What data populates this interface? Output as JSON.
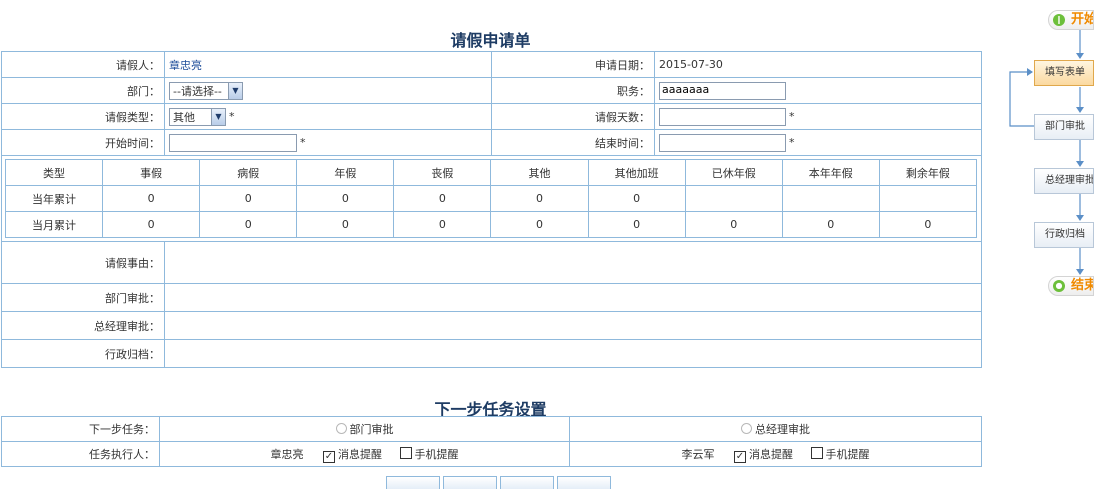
{
  "form": {
    "title": "请假申请单",
    "applicant_label": "请假人：",
    "applicant": "章忠亮",
    "date_label": "申请日期：",
    "date": "2015-07-30",
    "dept_label": "部门：",
    "dept_value": "--请选择--",
    "position_label": "职务：",
    "position_value": "aaaaaaa",
    "leave_type_label": "请假类型：",
    "leave_type_value": "其他",
    "leave_days_label": "请假天数：",
    "leave_days_value": "",
    "start_label": "开始时间：",
    "start_value": "",
    "end_label": "结束时间：",
    "end_value": "",
    "required_mark": "*"
  },
  "stats": {
    "headers": [
      "类型",
      "事假",
      "病假",
      "年假",
      "丧假",
      "其他",
      "其他加班",
      "已休年假",
      "本年年假",
      "剩余年假"
    ],
    "rows": [
      [
        "当年累计",
        "0",
        "0",
        "0",
        "0",
        "0",
        "0",
        "",
        "",
        ""
      ],
      [
        "当月累计",
        "0",
        "0",
        "0",
        "0",
        "0",
        "0",
        "0",
        "0",
        "0"
      ]
    ]
  },
  "details": {
    "reason_label": "请假事由：",
    "dept_approval_label": "部门审批：",
    "gm_approval_label": "总经理审批：",
    "admin_archive_label": "行政归档："
  },
  "next": {
    "title": "下一步任务设置",
    "task_label": "下一步任务：",
    "option1": "部门审批",
    "option2": "总经理审批",
    "executor_label": "任务执行人：",
    "executor1": "章忠亮",
    "executor2": "李云军",
    "msg_remind": "消息提醒",
    "phone_remind": "手机提醒",
    "check_mark": "✓"
  },
  "flow": {
    "start": "开始",
    "step1": "填写表单",
    "step2": "部门审批",
    "step3": "总经理审批",
    "step4": "行政归档",
    "end": "结束",
    "start_icon": "play-icon",
    "end_icon": "stop-icon"
  },
  "colors": {
    "border": "#8fb9dc",
    "title": "#1e3c64",
    "active_step": "#fbd9a0",
    "start_end_text": "#f08a00",
    "node_dot": "#6cbf3a"
  }
}
